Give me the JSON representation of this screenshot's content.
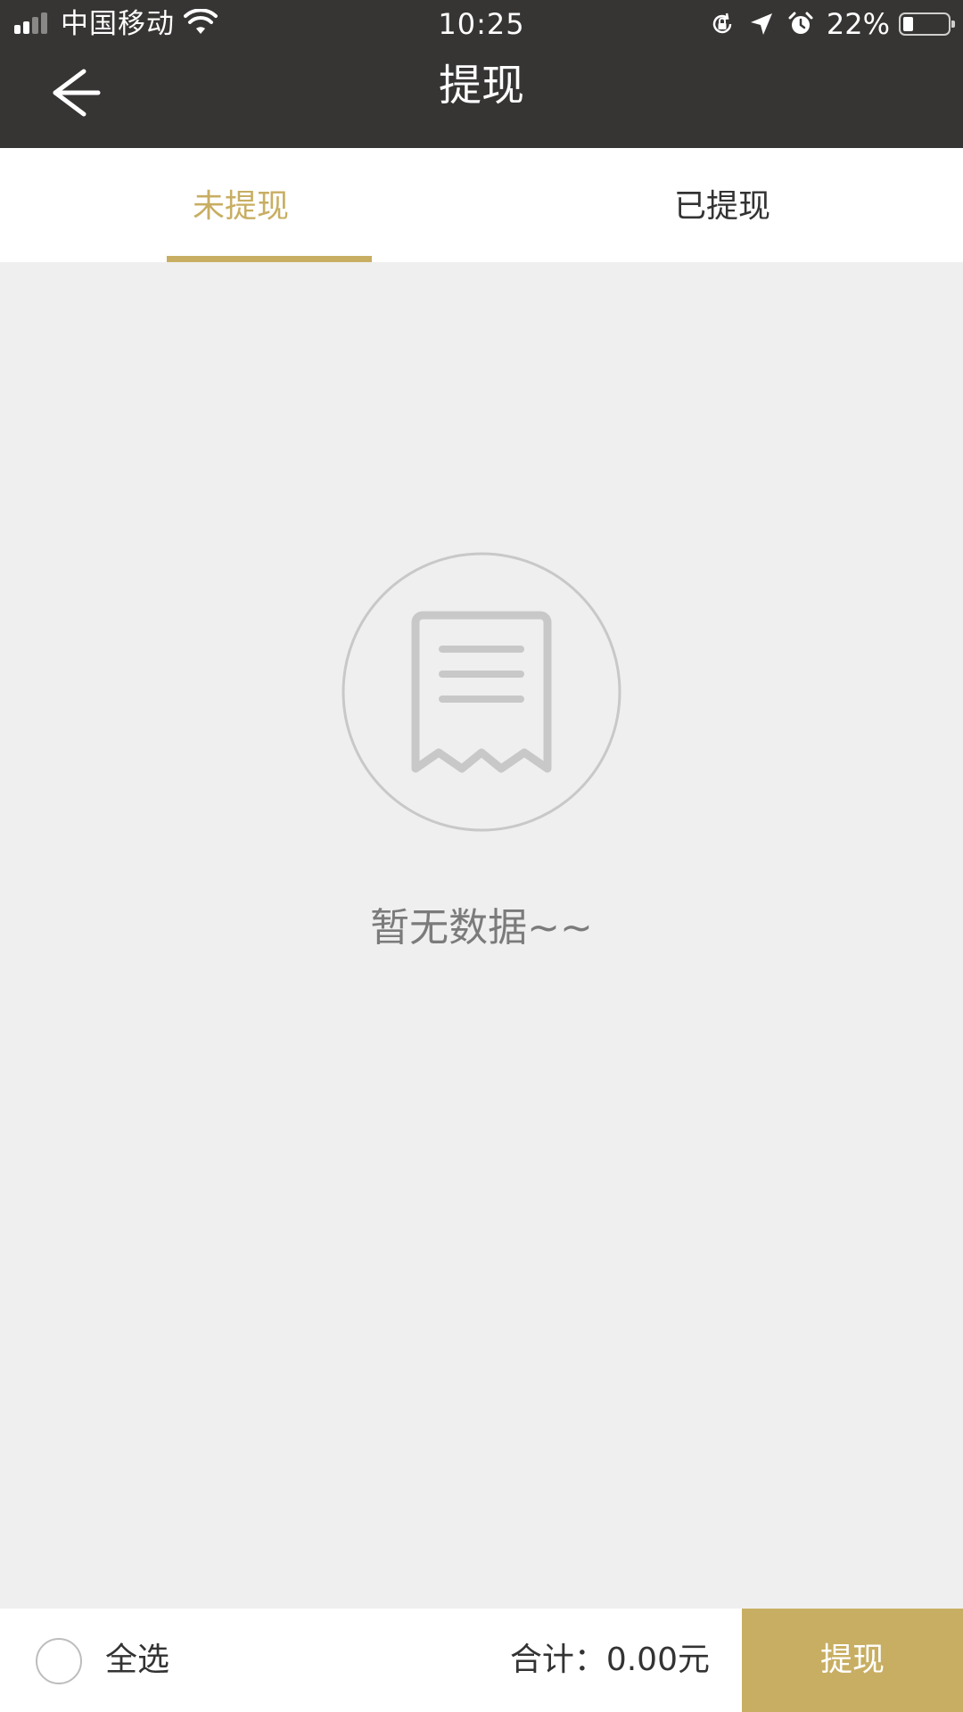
{
  "status_bar": {
    "carrier": "中国移动",
    "time": "10:25",
    "battery_percent": "22%",
    "battery_level": 0.22,
    "signal_bars_active": 2,
    "signal_bars_total": 4,
    "icons": [
      "signal-icon",
      "wifi-icon",
      "rotation-lock-icon",
      "location-icon",
      "alarm-icon",
      "battery-icon"
    ]
  },
  "nav": {
    "back_icon": "arrow-left-icon",
    "title": "提现"
  },
  "tabs": [
    {
      "label": "未提现",
      "active": true
    },
    {
      "label": "已提现",
      "active": false
    }
  ],
  "empty_state": {
    "icon": "receipt-icon",
    "message": "暂无数据~~"
  },
  "footer": {
    "select_all_label": "全选",
    "select_all_checked": false,
    "total_label": "合计：",
    "total_value": "0.00元",
    "withdraw_button": "提现"
  },
  "colors": {
    "header_bg": "#373534",
    "accent": "#c8ae62",
    "page_bg": "#efefef",
    "tab_inactive_text": "#333333",
    "muted_text": "#7b7b7b",
    "icon_gray": "#c8c8c8"
  }
}
